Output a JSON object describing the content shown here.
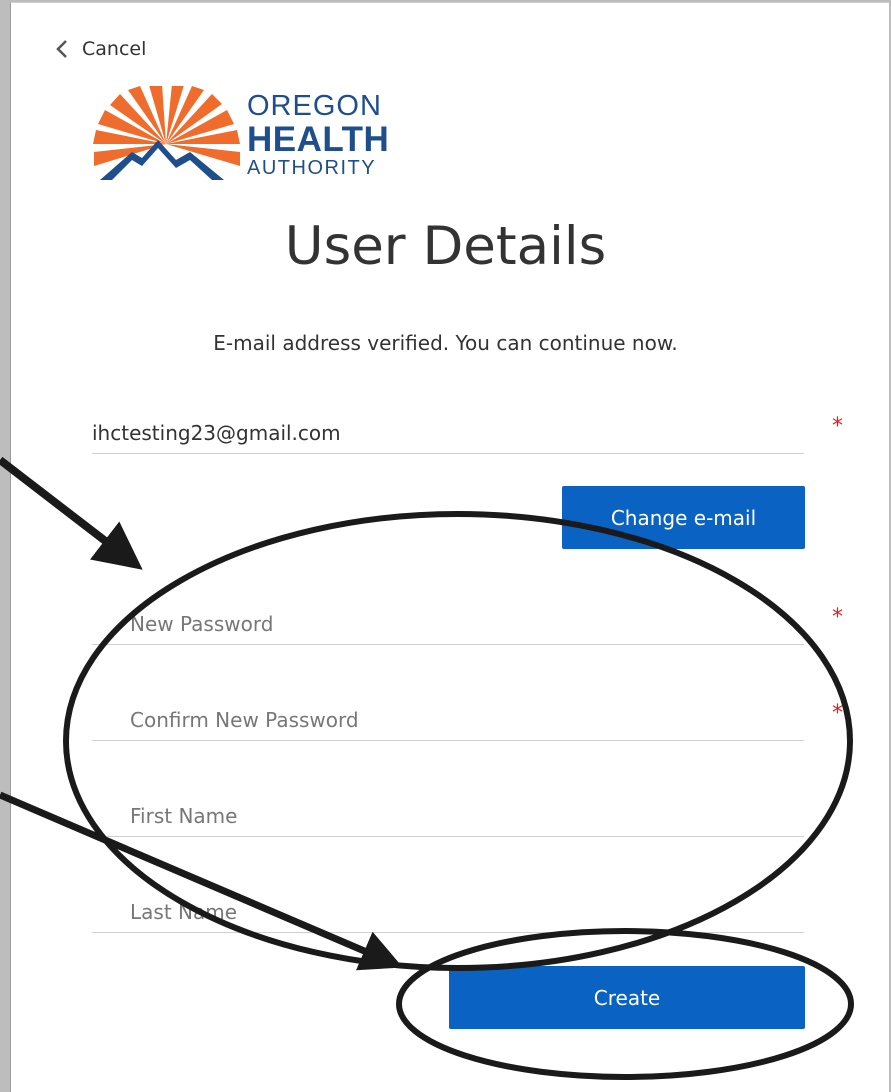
{
  "nav": {
    "cancel_label": "Cancel"
  },
  "logo": {
    "line1": "OREGON",
    "line2": "HEALTH",
    "line3": "AUTHORITY",
    "colors": {
      "sun": "#ef6c2c",
      "mountain": "#1f4e8c"
    }
  },
  "page": {
    "title": "User Details",
    "status_message": "E-mail address verified. You can continue now."
  },
  "form": {
    "email": {
      "value": "ihctesting23@gmail.com",
      "required": "*"
    },
    "change_email_label": "Change e-mail",
    "new_password": {
      "placeholder": "New Password",
      "required": "*"
    },
    "confirm_password": {
      "placeholder": "Confirm New Password",
      "required": "*"
    },
    "first_name": {
      "placeholder": "First Name"
    },
    "last_name": {
      "placeholder": "Last Name"
    },
    "create_label": "Create"
  },
  "colors": {
    "button": "#0a63c2",
    "required": "#e81c1c",
    "annotation": "#1a1a1a"
  }
}
